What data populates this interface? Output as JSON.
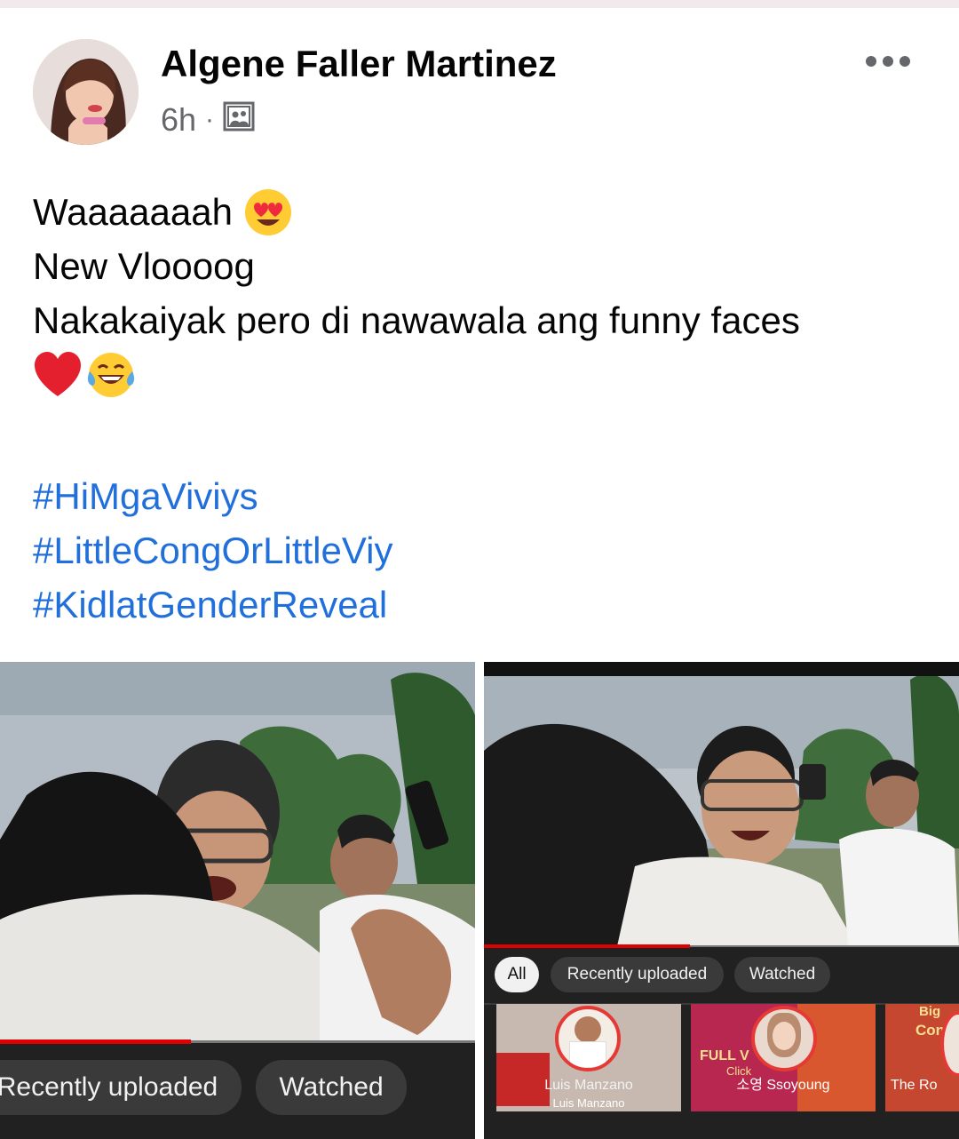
{
  "post": {
    "author": "Algene Faller Martinez",
    "time": "6h",
    "separator": "·",
    "audience_icon": "photo-album-icon",
    "lines": [
      "Waaaaaaah",
      "New Vloooog",
      "Nakakaiyak pero di nawawala ang funny faces"
    ],
    "emojis": [
      "heart-eyes-emoji",
      "red-heart-emoji",
      "laughing-tears-emoji"
    ],
    "hashtags": [
      "#HiMgaViviys",
      "#LittleCongOrLittleViy",
      "#KidlatGenderReveal"
    ]
  },
  "photo_left": {
    "chips": [
      "Recently uploaded",
      "Watched"
    ]
  },
  "photo_right": {
    "chips": [
      "All",
      "Recently uploaded",
      "Watched"
    ],
    "thumbs": [
      {
        "label": "Luis Manzano",
        "sublabel": "Luis Manzano"
      },
      {
        "label": "소영 Ssoyoung",
        "overlay": "FULL V",
        "overlay2": "Click"
      },
      {
        "label": "The Ro",
        "overlay": "Big",
        "overlay2": "Con"
      }
    ]
  },
  "colors": {
    "hashtag": "#216fdb",
    "meta": "#65676b",
    "yt_bar": "#212121",
    "progress": "#e00000"
  }
}
